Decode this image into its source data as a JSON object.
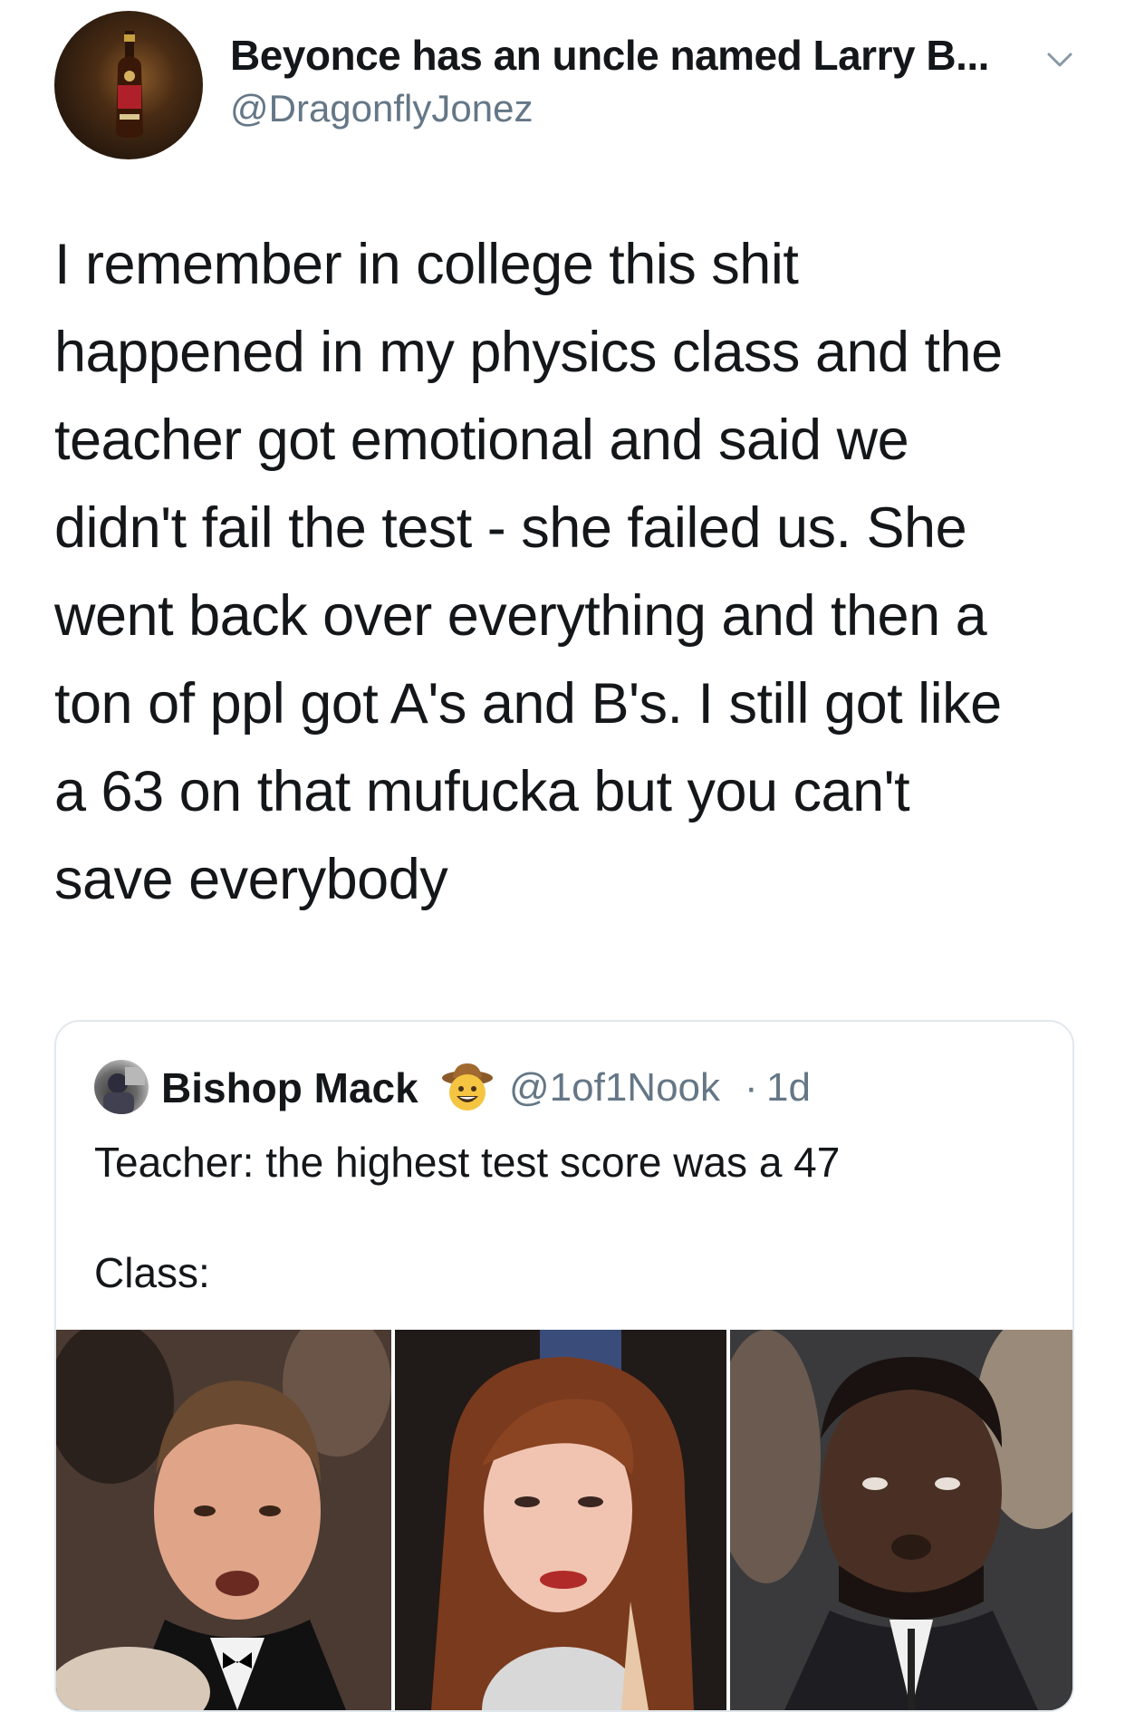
{
  "tweet": {
    "author_name": "Beyonce has an uncle named Larry B...",
    "author_handle": "@DragonflyJonez",
    "text": "I remember in college this shit\nhappened in my physics class and the\nteacher got emotional and said we\ndidn't fail the test - she failed us. She\nwent back over everything and then a\nton of ppl got A's and B's. I still got like\na 63 on that mufucka but you can't\nsave everybody"
  },
  "quoted_tweet": {
    "author_name": "Bishop Mack",
    "author_emoji": "cowboy-face-emoji",
    "author_handle": "@1of1Nook",
    "separator": "·",
    "time": "1d",
    "line1": "Teacher: the highest test score was a 47",
    "line2": "Class:",
    "media": [
      "man-in-tuxedo-photo",
      "red-haired-woman-photo",
      "man-in-suit-photo"
    ]
  },
  "icons": {
    "more": "chevron-down-icon"
  },
  "colors": {
    "text": "#14171a",
    "secondary": "#657786",
    "border": "#e1e8ed"
  }
}
